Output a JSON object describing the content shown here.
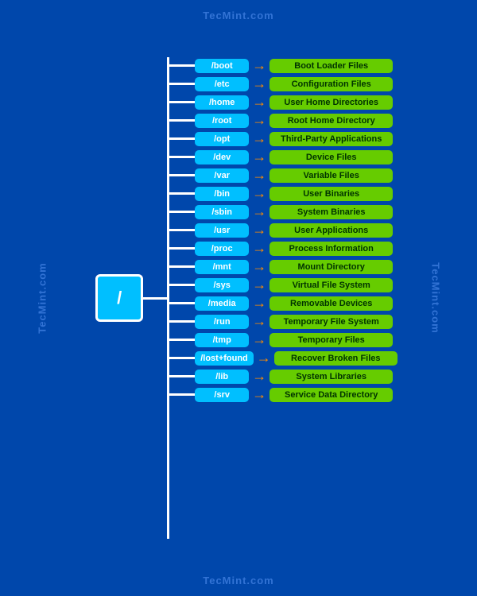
{
  "watermark": "TecMint.com",
  "root": "/",
  "entries": [
    {
      "dir": "/boot",
      "desc": "Boot Loader Files"
    },
    {
      "dir": "/etc",
      "desc": "Configuration Files"
    },
    {
      "dir": "/home",
      "desc": "User Home Directories"
    },
    {
      "dir": "/root",
      "desc": "Root Home Directory"
    },
    {
      "dir": "/opt",
      "desc": "Third-Party Applications"
    },
    {
      "dir": "/dev",
      "desc": "Device Files"
    },
    {
      "dir": "/var",
      "desc": "Variable Files"
    },
    {
      "dir": "/bin",
      "desc": "User Binaries"
    },
    {
      "dir": "/sbin",
      "desc": "System Binaries"
    },
    {
      "dir": "/usr",
      "desc": "User Applications"
    },
    {
      "dir": "/proc",
      "desc": "Process Information"
    },
    {
      "dir": "/mnt",
      "desc": "Mount Directory"
    },
    {
      "dir": "/sys",
      "desc": "Virtual File System"
    },
    {
      "dir": "/media",
      "desc": "Removable Devices"
    },
    {
      "dir": "/run",
      "desc": "Temporary File System"
    },
    {
      "dir": "/tmp",
      "desc": "Temporary Files"
    },
    {
      "dir": "/lost+found",
      "desc": "Recover Broken Files"
    },
    {
      "dir": "/lib",
      "desc": "System Libraries"
    },
    {
      "dir": "/srv",
      "desc": "Service Data Directory"
    }
  ]
}
